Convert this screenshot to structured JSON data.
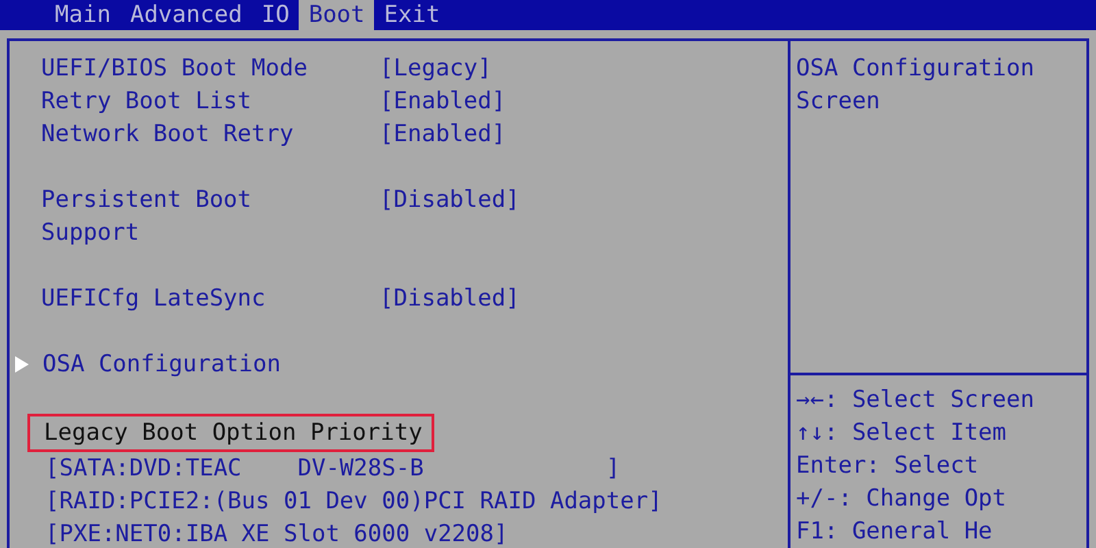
{
  "tabs": [
    {
      "label": "Main",
      "selected": false
    },
    {
      "label": "Advanced",
      "selected": false
    },
    {
      "label": "IO",
      "selected": false
    },
    {
      "label": "Boot",
      "selected": true
    },
    {
      "label": "Exit",
      "selected": false
    }
  ],
  "sections": [
    [
      {
        "kind": "setting",
        "label": "UEFI/BIOS Boot Mode",
        "value": "[Legacy]",
        "selected": false
      },
      {
        "kind": "setting",
        "label": "Retry Boot List",
        "value": "[Enabled]",
        "selected": false
      },
      {
        "kind": "setting",
        "label": "Network Boot Retry",
        "value": "[Enabled]",
        "selected": false
      }
    ],
    [
      {
        "kind": "setting",
        "label": "Persistent Boot Support",
        "value": "[Disabled]",
        "selected": false
      }
    ],
    [
      {
        "kind": "setting",
        "label": "UEFICfg LateSync",
        "value": "[Disabled]",
        "selected": false
      }
    ],
    [
      {
        "kind": "submenu",
        "label": "OSA Configuration",
        "selected": false
      }
    ],
    [
      {
        "kind": "header",
        "label": "Legacy Boot Option Priority",
        "selected": true
      },
      {
        "kind": "device",
        "label": "[SATA:DVD:TEAC    DV-W28S-B             ]",
        "selected": false
      },
      {
        "kind": "device",
        "label": "[RAID:PCIE2:(Bus 01 Dev 00)PCI RAID Adapter]",
        "selected": false
      },
      {
        "kind": "device",
        "label": "[PXE:NET0:IBA XE Slot 6000 v2208]",
        "selected": false
      }
    ]
  ],
  "help_text": "OSA Configuration Screen",
  "key_help": [
    "→←: Select Screen",
    "↑↓: Select Item",
    "Enter: Select",
    "+/-: Change Opt",
    "F1: General He"
  ]
}
